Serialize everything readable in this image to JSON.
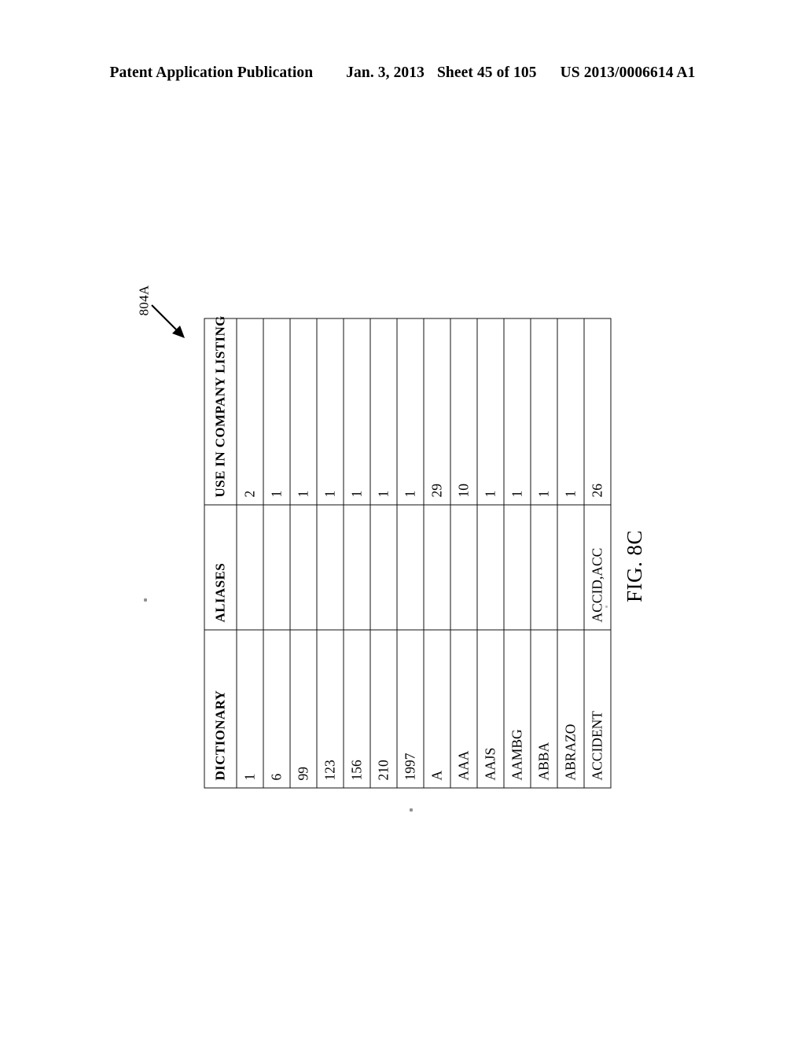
{
  "header": {
    "publication": "Patent Application Publication",
    "date": "Jan. 3, 2013",
    "sheet": "Sheet 45 of 105",
    "patent_number": "US 2013/0006614 A1"
  },
  "figure": {
    "label": "FIG. 8C",
    "reference_numeral": "804A"
  },
  "table": {
    "columns": [
      "DICTIONARY",
      "ALIASES",
      "USE IN COMPANY LISTING"
    ],
    "rows": [
      {
        "dictionary": "1",
        "aliases": "",
        "use_in_company_listing": "2"
      },
      {
        "dictionary": "6",
        "aliases": "",
        "use_in_company_listing": "1"
      },
      {
        "dictionary": "99",
        "aliases": "",
        "use_in_company_listing": "1"
      },
      {
        "dictionary": "123",
        "aliases": "",
        "use_in_company_listing": "1"
      },
      {
        "dictionary": "156",
        "aliases": "",
        "use_in_company_listing": "1"
      },
      {
        "dictionary": "210",
        "aliases": "",
        "use_in_company_listing": "1"
      },
      {
        "dictionary": "1997",
        "aliases": "",
        "use_in_company_listing": "1"
      },
      {
        "dictionary": "A",
        "aliases": "",
        "use_in_company_listing": "29"
      },
      {
        "dictionary": "AAA",
        "aliases": "",
        "use_in_company_listing": "10"
      },
      {
        "dictionary": "AAJS",
        "aliases": "",
        "use_in_company_listing": "1"
      },
      {
        "dictionary": "AAMBG",
        "aliases": "",
        "use_in_company_listing": "1"
      },
      {
        "dictionary": "ABBA",
        "aliases": "",
        "use_in_company_listing": "1"
      },
      {
        "dictionary": "ABRAZO",
        "aliases": "",
        "use_in_company_listing": "1"
      },
      {
        "dictionary": "ACCIDENT",
        "aliases": "ACCID,ACC",
        "use_in_company_listing": "26"
      }
    ]
  }
}
